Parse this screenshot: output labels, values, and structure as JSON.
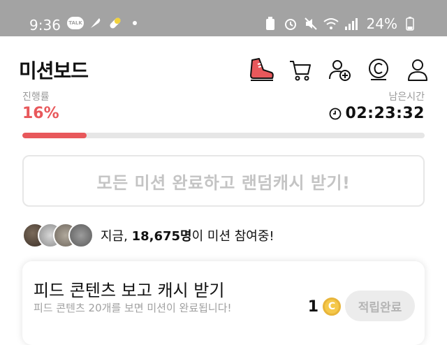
{
  "status_bar": {
    "time": "9:36",
    "talk_badge": "TALK",
    "battery_pct": "24%"
  },
  "header": {
    "title": "미션보드",
    "icons": [
      "shoe-icon",
      "cart-icon",
      "add-friend-icon",
      "cash-coin-icon",
      "profile-icon"
    ]
  },
  "progress": {
    "left_label_partial": "진행률",
    "right_label_partial": "남은시간",
    "percent_text": "16%",
    "percent_value": 16,
    "timer": "02:23:32",
    "accent_color": "#e8585b"
  },
  "complete_all": {
    "label": "모든 미션 완료하고 랜덤캐시 받기!"
  },
  "participants": {
    "prefix": "지금, ",
    "count": "18,675명",
    "suffix": "이 미션 참여중!"
  },
  "mission": {
    "title": "피드 콘텐츠 보고 캐시 받기",
    "subtitle": "피드 콘텐츠 20개를 보면 미션이 완료됩니다!",
    "reward_amount": "1",
    "coin_symbol": "C",
    "button_label": "적립완료"
  }
}
